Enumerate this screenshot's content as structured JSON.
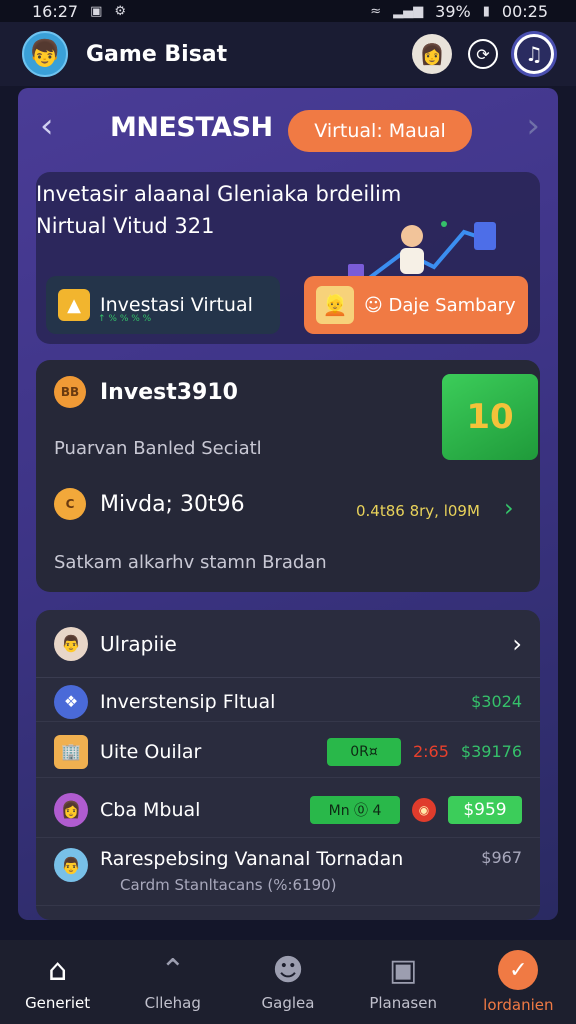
{
  "status_bar": {
    "time": "16:27",
    "battery": "39%",
    "clock": "00:25"
  },
  "header": {
    "app_title": "Game Bisat"
  },
  "nav": {
    "heading": "MNESTASH",
    "mode_label": "Virtual: Maual"
  },
  "hero": {
    "line1": "Invetasir alaanal Gleniaka brdeilim",
    "line2": "Nirtual Vitud 321",
    "left_button": "Investasi Virtual",
    "left_button_sub": "↑ % % % %",
    "right_button": "☺ Daje Sambary"
  },
  "invest": {
    "title": "Invest3910",
    "subtitle": "Puarvan Banled Seciatl",
    "badge": "10",
    "coin1": "BB",
    "coin2": "C",
    "second_title": "Mivda; 30t96",
    "stat": "0.4t86 8ry, l09M",
    "footer": "Satkam alkarhv stamn Bradan"
  },
  "list": {
    "header_label": "Ulrapiie",
    "rows": [
      {
        "name": "Inverstensip Fltual",
        "value": "$3024"
      },
      {
        "name": "Uite Ouilar",
        "pill": "0R¤",
        "red_value": "2:65",
        "value": "$39176"
      },
      {
        "name": "Cba Mbual",
        "pill": "Mn ⓪ 4",
        "value": "$959"
      },
      {
        "name": "Rarespebsing Vananal Tornadan",
        "sub": "Cardm Stanltacans (%:6190)",
        "value": "$967"
      }
    ]
  },
  "tabs": [
    {
      "label": "Generiet",
      "icon": "home-icon"
    },
    {
      "label": "Cllehag",
      "icon": "house-outline-icon"
    },
    {
      "label": "Gaglea",
      "icon": "smile-icon"
    },
    {
      "label": "Planasen",
      "icon": "lock-icon"
    },
    {
      "label": "lordanien",
      "icon": "check-icon"
    }
  ],
  "colors": {
    "accent_orange": "#f07a44",
    "positive_green": "#35c06a",
    "panel_purple": "#4a3c96"
  }
}
